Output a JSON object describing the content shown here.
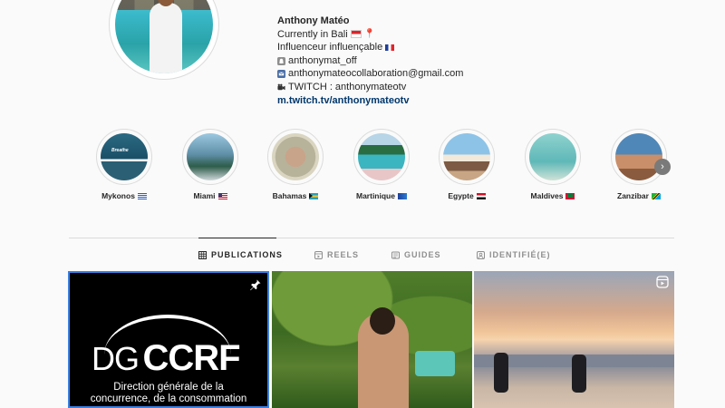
{
  "profile": {
    "name": "Anthony Matéo",
    "bio_lines": [
      {
        "text": "Currently in Bali",
        "emoji": "📍",
        "flag": "id"
      },
      {
        "text": "Influenceur influençable",
        "flag": "fr"
      }
    ],
    "socials": [
      {
        "icon": "snapchat-ghost-icon",
        "text": "anthonymat_off"
      },
      {
        "icon": "email-icon",
        "text": "anthonymateocollaboration@gmail.com"
      },
      {
        "icon": "video-camera-icon",
        "text": "TWITCH : anthonymateotv"
      }
    ],
    "link": "m.twitch.tv/anthonymateotv"
  },
  "highlights": [
    {
      "label": "Mykonos",
      "flag": "gr",
      "thumb_text": "Breathe"
    },
    {
      "label": "Miami",
      "flag": "us"
    },
    {
      "label": "Bahamas",
      "flag": "bs"
    },
    {
      "label": "Martinique",
      "flag": "mq"
    },
    {
      "label": "Egypte",
      "flag": "eg"
    },
    {
      "label": "Maldives",
      "flag": "mv"
    },
    {
      "label": "Zanzibar",
      "flag": "tz"
    }
  ],
  "tabs": [
    {
      "label": "PUBLICATIONS",
      "icon": "grid-icon",
      "active": true
    },
    {
      "label": "REELS",
      "icon": "reels-icon",
      "active": false
    },
    {
      "label": "GUIDES",
      "icon": "guides-icon",
      "active": false
    },
    {
      "label": "IDENTIFIÉ(E)",
      "icon": "tagged-icon",
      "active": false
    }
  ],
  "posts": [
    {
      "type": "image",
      "pinned": true,
      "logo_left": "DG",
      "logo_right": "CCRF",
      "caption_lines": [
        "Direction générale de la",
        "concurrence, de la consommation"
      ]
    },
    {
      "type": "image",
      "pinned": false
    },
    {
      "type": "reel",
      "pinned": false
    }
  ],
  "colors": {
    "link": "#00376b",
    "selected_border": "#3b7fe0",
    "divider": "#dbdbdb"
  }
}
